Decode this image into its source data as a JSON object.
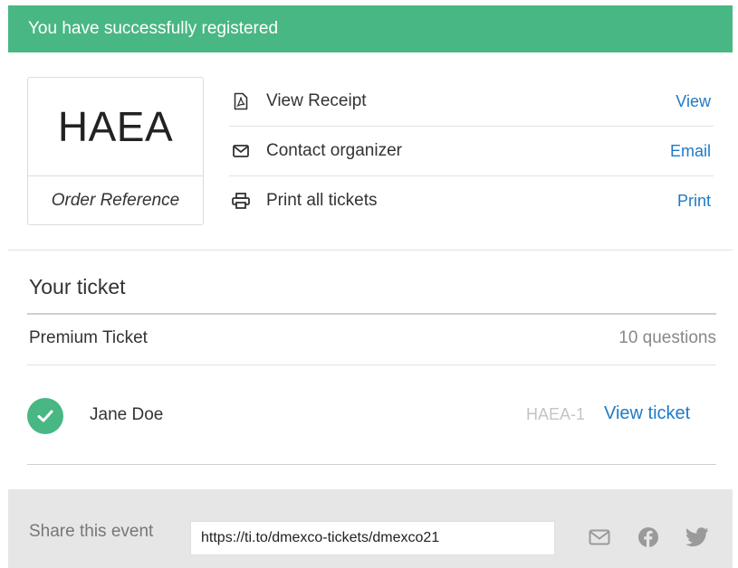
{
  "banner": {
    "message": "You have successfully registered"
  },
  "order": {
    "reference": "HAEA",
    "reference_label": "Order Reference"
  },
  "actions": [
    {
      "icon": "pdf-file-icon",
      "label": "View Receipt",
      "link": "View"
    },
    {
      "icon": "envelope-icon",
      "label": "Contact organizer",
      "link": "Email"
    },
    {
      "icon": "printer-icon",
      "label": "Print all tickets",
      "link": "Print"
    }
  ],
  "tickets": {
    "title": "Your ticket",
    "type_name": "Premium Ticket",
    "questions": "10 questions",
    "attendee": {
      "name": "Jane Doe",
      "ref": "HAEA-1",
      "link": "View ticket",
      "status_icon": "checkmark-circle-icon"
    }
  },
  "share": {
    "label": "Share this event",
    "url": "https://ti.to/dmexco-tickets/dmexco21",
    "icons": [
      "envelope-icon",
      "facebook-icon",
      "twitter-icon"
    ]
  },
  "colors": {
    "success": "#48b784",
    "link": "#1f7ac7",
    "share_bg": "#e6e6e6",
    "muted": "#c4c4c4"
  }
}
